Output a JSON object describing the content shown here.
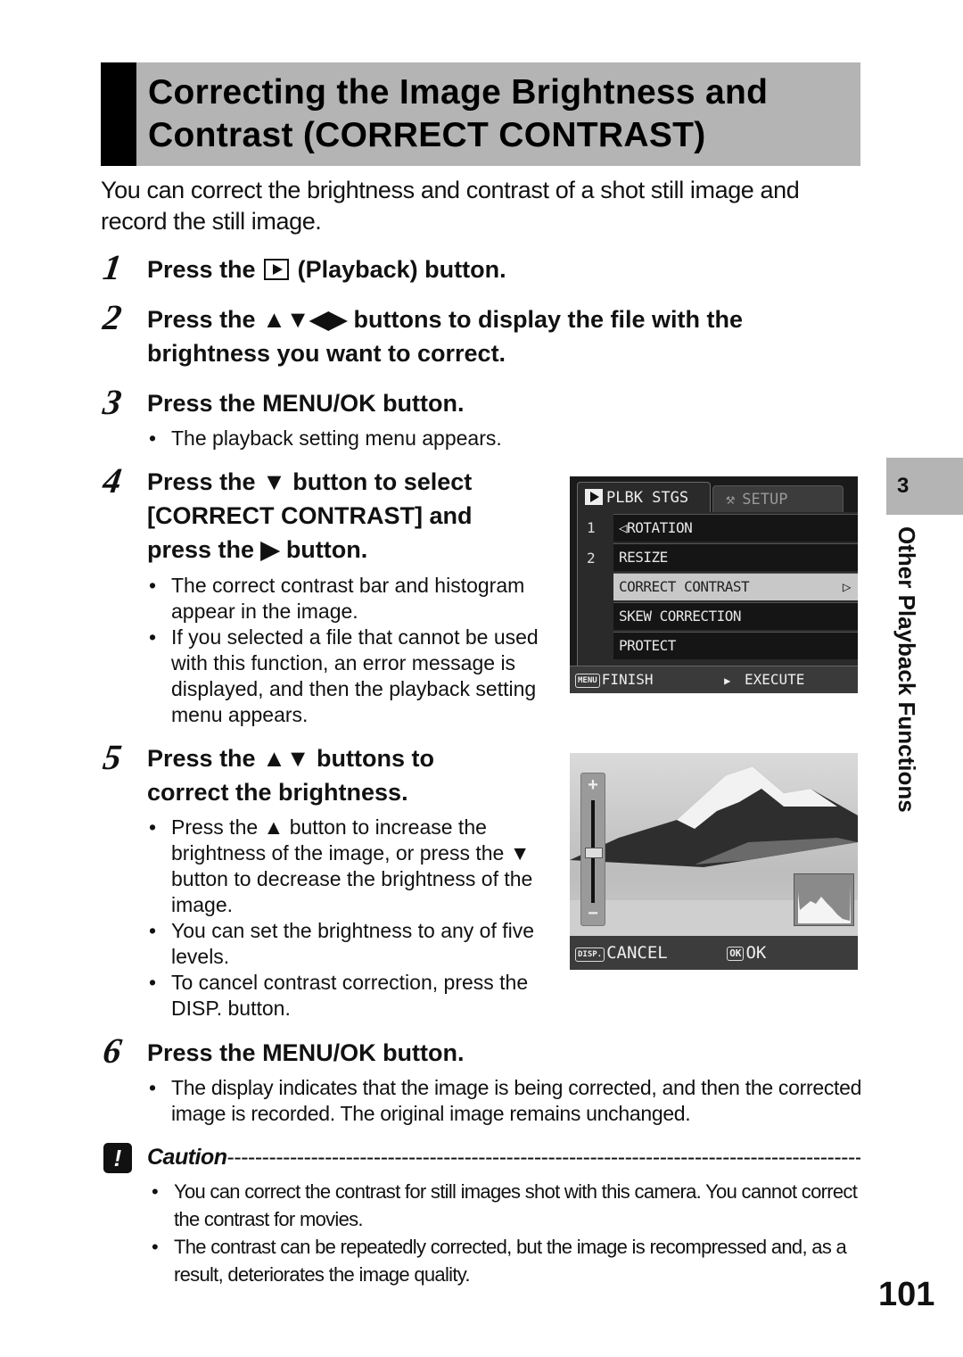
{
  "title": "Correcting the Image Brightness and Contrast (CORRECT CONTRAST)",
  "title_lines": [
    "Correcting the Image Brightness and",
    "Contrast (CORRECT CONTRAST)"
  ],
  "intro": "You can correct the brightness and contrast of a shot still image and record the still image.",
  "steps": [
    {
      "num": "1",
      "pre": "Press the",
      "icon": "playback-icon",
      "post": "(Playback) button.",
      "bullets": []
    },
    {
      "num": "2",
      "text": "Press the ▲▼◀▶ buttons to display the file with the brightness you want to correct.",
      "bullets": []
    },
    {
      "num": "3",
      "text": "Press the MENU/OK button.",
      "bullets": [
        "The playback setting menu appears."
      ]
    },
    {
      "num": "4",
      "text": "Press the ▼ button to select [CORRECT CONTRAST] and press the ▶ button.",
      "bullets": [
        "The correct contrast bar and histogram appear in the image.",
        "If you selected a file that cannot be used with this function, an error message is displayed, and then the playback setting menu appears."
      ]
    },
    {
      "num": "5",
      "text": "Press the ▲▼ buttons to correct the brightness.",
      "bullets": [
        "Press the ▲ button to increase the brightness of the image, or press the ▼ button to decrease the brightness of the image.",
        "You can set the brightness to any of five levels.",
        "To cancel contrast correction, press the DISP. button."
      ]
    },
    {
      "num": "6",
      "text": "Press the MENU/OK button.",
      "bullets": [
        "The display indicates that the image is being corrected, and then the corrected image is recorded. The original image remains unchanged."
      ]
    }
  ],
  "menu_screen": {
    "tab_active": "PLBK STGS",
    "tab_inactive": "SETUP",
    "page_indicators": [
      "1",
      "2"
    ],
    "items": [
      "ROTATION",
      "RESIZE",
      "CORRECT CONTRAST",
      "SKEW CORRECTION",
      "PROTECT"
    ],
    "selected_index": 2,
    "selected_arrow": "▷",
    "footer_key": "MENU",
    "footer_left": "FINISH",
    "footer_right": "EXECUTE"
  },
  "brightness_screen": {
    "slider_plus": "+",
    "slider_minus": "−",
    "brightness_level": 3,
    "brightness_levels": 5,
    "cancel_key": "DISP.",
    "cancel_label": "CANCEL",
    "ok_key": "OK",
    "ok_label": "OK"
  },
  "chapter": {
    "number": "3",
    "label": "Other Playback Functions"
  },
  "caution": {
    "title": "Caution",
    "items": [
      "You can correct the contrast for still images shot with this camera. You cannot correct the contrast for movies.",
      "The contrast can be repeatedly corrected, but the image is recompressed and, as a result, deteriorates the image quality."
    ]
  },
  "page_number": "101"
}
